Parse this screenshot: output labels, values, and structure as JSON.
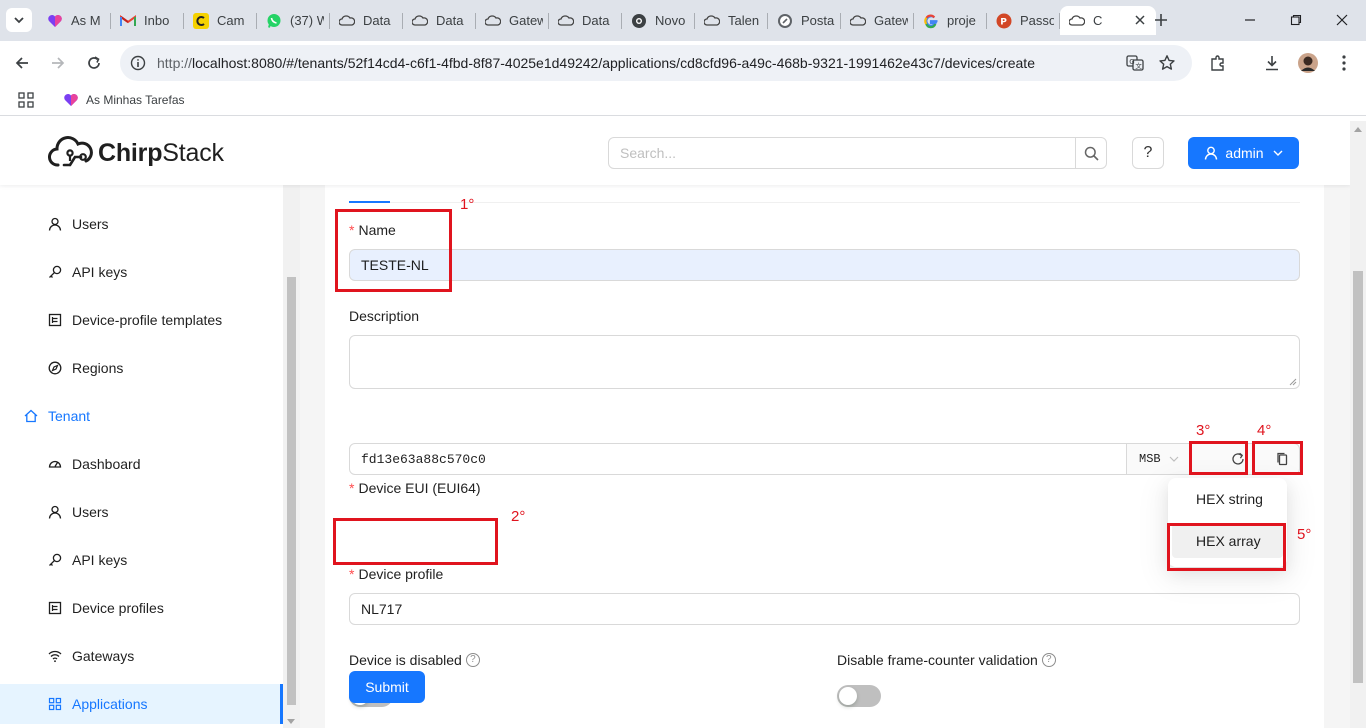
{
  "browser": {
    "tabs": [
      {
        "title": "As M",
        "icon": "tasks-heart-icon"
      },
      {
        "title": "Inbo",
        "icon": "gmail-icon"
      },
      {
        "title": "Cam",
        "icon": "camscanner-icon"
      },
      {
        "title": "(37) W",
        "icon": "whatsapp-icon"
      },
      {
        "title": "Data",
        "icon": "chirpstack-icon"
      },
      {
        "title": "Data",
        "icon": "chirpstack-icon"
      },
      {
        "title": "Gatew",
        "icon": "chirpstack-icon"
      },
      {
        "title": "Data",
        "icon": "chirpstack-icon"
      },
      {
        "title": "Novo",
        "icon": "github-icon"
      },
      {
        "title": "Talen",
        "icon": "chirpstack-icon"
      },
      {
        "title": "Posta",
        "icon": "postman-icon"
      },
      {
        "title": "Gatew",
        "icon": "chirpstack-icon"
      },
      {
        "title": "proje",
        "icon": "google-icon"
      },
      {
        "title": "Passo",
        "icon": "powerpoint-icon"
      }
    ],
    "active_tab_title": "C",
    "url_scheme": "http://",
    "url_rest": "localhost:8080/#/tenants/52f14cd4-c6f1-4fbd-8f87-4025e1d49242/applications/cd8cfd96-a49c-468b-9321-1991462e43c7/devices/create",
    "bookmark": "As Minhas Tarefas"
  },
  "header": {
    "logo_light": "Chirp",
    "logo_bold": "Stack",
    "search_placeholder": "Search...",
    "help_label": "?",
    "user_label": "admin"
  },
  "sidebar": {
    "items": [
      {
        "label": "Users",
        "icon": "user-icon",
        "level": 2
      },
      {
        "label": "API keys",
        "icon": "key-icon",
        "level": 2
      },
      {
        "label": "Device-profile templates",
        "icon": "profile-icon",
        "level": 2
      },
      {
        "label": "Regions",
        "icon": "compass-icon",
        "level": 2
      },
      {
        "label": "Tenant",
        "icon": "home-icon",
        "level": 1
      },
      {
        "label": "Dashboard",
        "icon": "dashboard-icon",
        "level": 2
      },
      {
        "label": "Users",
        "icon": "user-icon",
        "level": 2
      },
      {
        "label": "API keys",
        "icon": "key-icon",
        "level": 2
      },
      {
        "label": "Device profiles",
        "icon": "profile-icon",
        "level": 2
      },
      {
        "label": "Gateways",
        "icon": "wifi-icon",
        "level": 2
      },
      {
        "label": "Applications",
        "icon": "apps-icon",
        "level": 2,
        "selected": true
      }
    ]
  },
  "form": {
    "name_label": "Name",
    "name_value": "TESTE-NL",
    "description_label": "Description",
    "description_value": "",
    "eui_label": "Device EUI (EUI64)",
    "eui_value": "fd13e63a88c570c0",
    "byte_order": "MSB",
    "profile_label": "Device profile",
    "profile_value": "NL717",
    "disabled_label": "Device is disabled",
    "disabled_value": false,
    "fcnt_label": "Disable frame-counter validation",
    "fcnt_value": false,
    "submit_label": "Submit"
  },
  "dropdown": {
    "items": [
      "HEX string",
      "HEX array"
    ],
    "highlighted": "HEX array"
  },
  "annotations": [
    "1°",
    "2°",
    "3°",
    "4°",
    "5°"
  ],
  "colors": {
    "primary": "#1677ff",
    "annotation": "#e0141e",
    "required": "#ff4d4f",
    "autofill": "#e8f0fe"
  }
}
